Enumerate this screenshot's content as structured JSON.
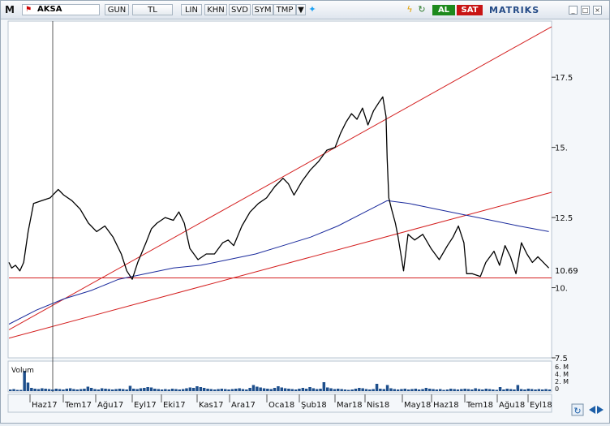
{
  "toolbar": {
    "logo": "M",
    "symbol": "AKSA",
    "symbol_icon": "flag-icon",
    "buttons": [
      "GUN",
      "TL",
      "LIN",
      "KHN",
      "SVD",
      "SYM",
      "TMP"
    ],
    "dropdown_icon": "triangle-down-icon",
    "twitter_icon": "bird-icon",
    "flash_icon": "lightning-icon",
    "refresh_icon": "cycle-icon",
    "buy_label": "AL",
    "sell_label": "SAT",
    "brand": "MATRIKS",
    "window_controls": [
      "minimize",
      "maximize",
      "close"
    ]
  },
  "colors": {
    "price": "#000000",
    "ma": "#1a2a9c",
    "trendline": "#d42020",
    "volume": "#1e4f8c",
    "buy": "#1d8a1d",
    "sell": "#c81414"
  },
  "chart_data": {
    "type": "line",
    "price_ticks": [
      "17.5",
      "15.",
      "12.5",
      "10.69",
      "10.",
      "7.5"
    ],
    "current_price": "10.69",
    "x_labels": [
      "Haz17",
      "Tem17",
      "Ağu17",
      "Eyl17",
      "Eki17",
      "Kas17",
      "Ara17",
      "Oca18",
      "Şub18",
      "Mar18",
      "Nis18",
      "May18",
      "Haz18",
      "Tem18",
      "Ağu18",
      "Eyl18"
    ],
    "ylim": [
      7.5,
      19.5
    ],
    "price_series": [
      [
        0,
        10.9
      ],
      [
        0.05,
        10.7
      ],
      [
        0.12,
        10.8
      ],
      [
        0.2,
        10.6
      ],
      [
        0.27,
        10.9
      ],
      [
        0.35,
        12.0
      ],
      [
        0.45,
        13.0
      ],
      [
        0.6,
        13.1
      ],
      [
        0.75,
        13.2
      ],
      [
        0.9,
        13.5
      ],
      [
        1.0,
        13.3
      ],
      [
        1.15,
        13.1
      ],
      [
        1.3,
        12.8
      ],
      [
        1.45,
        12.3
      ],
      [
        1.6,
        12.0
      ],
      [
        1.75,
        12.2
      ],
      [
        1.9,
        11.8
      ],
      [
        2.05,
        11.2
      ],
      [
        2.15,
        10.6
      ],
      [
        2.25,
        10.3
      ],
      [
        2.35,
        10.9
      ],
      [
        2.5,
        11.6
      ],
      [
        2.6,
        12.1
      ],
      [
        2.7,
        12.3
      ],
      [
        2.85,
        12.5
      ],
      [
        3.0,
        12.4
      ],
      [
        3.1,
        12.7
      ],
      [
        3.2,
        12.3
      ],
      [
        3.3,
        11.4
      ],
      [
        3.45,
        11.0
      ],
      [
        3.6,
        11.2
      ],
      [
        3.75,
        11.2
      ],
      [
        3.9,
        11.6
      ],
      [
        4.0,
        11.7
      ],
      [
        4.1,
        11.5
      ],
      [
        4.25,
        12.2
      ],
      [
        4.4,
        12.7
      ],
      [
        4.55,
        13.0
      ],
      [
        4.7,
        13.2
      ],
      [
        4.85,
        13.6
      ],
      [
        5.0,
        13.9
      ],
      [
        5.1,
        13.7
      ],
      [
        5.2,
        13.3
      ],
      [
        5.35,
        13.8
      ],
      [
        5.5,
        14.2
      ],
      [
        5.65,
        14.5
      ],
      [
        5.8,
        14.9
      ],
      [
        5.95,
        15.0
      ],
      [
        6.05,
        15.5
      ],
      [
        6.15,
        15.9
      ],
      [
        6.25,
        16.2
      ],
      [
        6.35,
        16.0
      ],
      [
        6.45,
        16.4
      ],
      [
        6.55,
        15.8
      ],
      [
        6.65,
        16.3
      ],
      [
        6.75,
        16.6
      ],
      [
        6.82,
        16.8
      ],
      [
        6.88,
        16.1
      ],
      [
        6.9,
        14.6
      ],
      [
        6.93,
        13.2
      ],
      [
        6.98,
        12.8
      ],
      [
        7.05,
        12.3
      ],
      [
        7.1,
        11.8
      ],
      [
        7.2,
        10.6
      ],
      [
        7.28,
        11.9
      ],
      [
        7.4,
        11.7
      ],
      [
        7.55,
        11.9
      ],
      [
        7.7,
        11.4
      ],
      [
        7.85,
        11.0
      ],
      [
        8.0,
        11.5
      ],
      [
        8.1,
        11.8
      ],
      [
        8.2,
        12.2
      ],
      [
        8.3,
        11.6
      ],
      [
        8.35,
        10.5
      ],
      [
        8.45,
        10.5
      ],
      [
        8.6,
        10.4
      ],
      [
        8.7,
        10.9
      ],
      [
        8.85,
        11.3
      ],
      [
        8.95,
        10.8
      ],
      [
        9.05,
        11.5
      ],
      [
        9.15,
        11.1
      ],
      [
        9.25,
        10.5
      ],
      [
        9.35,
        11.6
      ],
      [
        9.45,
        11.2
      ],
      [
        9.55,
        10.9
      ],
      [
        9.65,
        11.1
      ],
      [
        9.75,
        10.9
      ],
      [
        9.85,
        10.7
      ]
    ],
    "ma_series": [
      [
        0,
        8.7
      ],
      [
        0.5,
        9.2
      ],
      [
        1.0,
        9.6
      ],
      [
        1.5,
        9.9
      ],
      [
        2.0,
        10.3
      ],
      [
        2.5,
        10.5
      ],
      [
        3.0,
        10.7
      ],
      [
        3.5,
        10.8
      ],
      [
        4.0,
        11.0
      ],
      [
        4.5,
        11.2
      ],
      [
        5.0,
        11.5
      ],
      [
        5.5,
        11.8
      ],
      [
        6.0,
        12.2
      ],
      [
        6.5,
        12.7
      ],
      [
        6.9,
        13.1
      ],
      [
        7.3,
        13.0
      ],
      [
        7.8,
        12.8
      ],
      [
        8.3,
        12.6
      ],
      [
        8.8,
        12.4
      ],
      [
        9.3,
        12.2
      ],
      [
        9.85,
        12.0
      ]
    ],
    "trendlines": [
      {
        "from": [
          0,
          8.5
        ],
        "to": [
          9.9,
          19.3
        ]
      },
      {
        "from": [
          0,
          8.2
        ],
        "to": [
          9.9,
          13.4
        ]
      },
      {
        "from": [
          0,
          10.35
        ],
        "to": [
          9.9,
          10.35
        ]
      }
    ],
    "volume_label": "Volum",
    "volume_ticks": [
      "6. M",
      "4. M",
      "2. M",
      "0"
    ],
    "volume_values": [
      0.4,
      0.5,
      0.3,
      0.3,
      5.0,
      2.1,
      0.8,
      0.6,
      0.5,
      0.7,
      0.6,
      0.5,
      0.4,
      0.6,
      0.5,
      0.4,
      0.6,
      0.7,
      0.5,
      0.4,
      0.5,
      0.6,
      1.1,
      0.8,
      0.5,
      0.4,
      0.7,
      0.6,
      0.5,
      0.4,
      0.5,
      0.6,
      0.5,
      0.4,
      1.3,
      0.6,
      0.5,
      0.7,
      0.8,
      1.0,
      0.9,
      0.6,
      0.5,
      0.4,
      0.5,
      0.4,
      0.6,
      0.5,
      0.4,
      0.5,
      0.7,
      0.9,
      0.8,
      1.2,
      1.0,
      0.8,
      0.6,
      0.5,
      0.4,
      0.5,
      0.6,
      0.5,
      0.4,
      0.5,
      0.6,
      0.7,
      0.5,
      0.4,
      0.8,
      1.5,
      1.1,
      0.9,
      0.7,
      0.6,
      0.5,
      0.8,
      1.2,
      0.9,
      0.7,
      0.6,
      0.5,
      0.4,
      0.6,
      0.8,
      0.6,
      1.0,
      0.7,
      0.5,
      0.6,
      2.2,
      0.9,
      0.7,
      0.5,
      0.6,
      0.5,
      0.4,
      0.3,
      0.4,
      0.6,
      0.8,
      0.7,
      0.5,
      0.4,
      0.5,
      1.8,
      0.6,
      0.5,
      1.5,
      0.7,
      0.5,
      0.4,
      0.5,
      0.6,
      0.4,
      0.5,
      0.6,
      0.4,
      0.5,
      0.8,
      0.6,
      0.5,
      0.4,
      0.5,
      0.3,
      0.4,
      0.6,
      0.5,
      0.4,
      0.5,
      0.6,
      0.5,
      0.4,
      0.7,
      0.5,
      0.4,
      0.6,
      0.5,
      0.4,
      0.3,
      1.0,
      0.4,
      0.6,
      0.5,
      0.4,
      1.5,
      0.5,
      0.4,
      0.6,
      0.5,
      0.4,
      0.5,
      0.4,
      0.5,
      0.4
    ]
  }
}
